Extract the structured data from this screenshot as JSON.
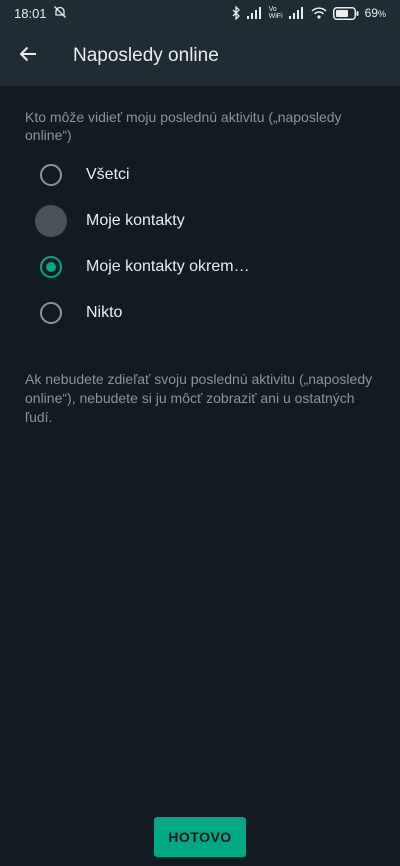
{
  "status_bar": {
    "time": "18:01",
    "volte_label": "Vo",
    "wifi_label": "WiFi",
    "battery_percent": "69",
    "battery_unit": "%"
  },
  "header": {
    "title": "Naposledy online"
  },
  "question": "Kto môže vidieť moju poslednú aktivitu („naposledy online“)",
  "options": [
    {
      "label": "Všetci",
      "selected": false
    },
    {
      "label": "Moje kontakty",
      "selected": false
    },
    {
      "label": "Moje kontakty okrem…",
      "selected": true
    },
    {
      "label": "Nikto",
      "selected": false
    }
  ],
  "footnote": "Ak nebudete zdieľať svoju poslednú aktivitu („naposledy online“), nebudete si ju môcť zobraziť ani u ostatných ľudí.",
  "done_button": "HOTOVO",
  "colors": {
    "accent": "#00a884",
    "background": "#111b21",
    "toolbar": "#1f2c34",
    "secondary_text": "#8696a0",
    "primary_text": "#e9edef"
  }
}
